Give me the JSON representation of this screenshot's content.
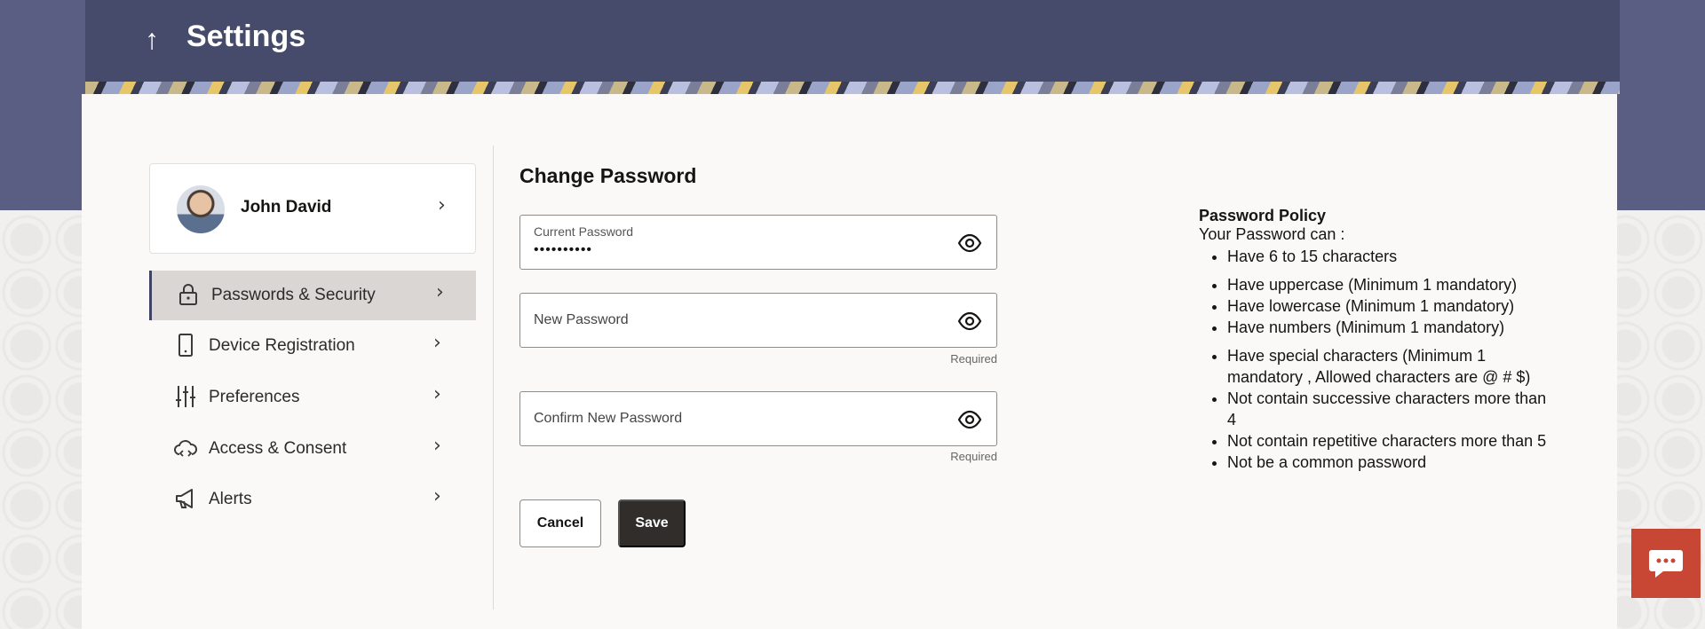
{
  "header": {
    "title": "Settings",
    "back_icon": "arrow-up-icon"
  },
  "profile": {
    "name": "John David"
  },
  "nav": {
    "items": [
      {
        "label": "Passwords & Security",
        "icon": "lock-icon",
        "active": true
      },
      {
        "label": "Device Registration",
        "icon": "mobile-device-icon",
        "active": false
      },
      {
        "label": "Preferences",
        "icon": "sliders-icon",
        "active": false
      },
      {
        "label": "Access & Consent",
        "icon": "cloud-access-icon",
        "active": false
      },
      {
        "label": "Alerts",
        "icon": "megaphone-icon",
        "active": false
      }
    ]
  },
  "form": {
    "title": "Change Password",
    "current_password": {
      "label": "Current Password",
      "value": "••••••••••"
    },
    "new_password": {
      "label": "New Password",
      "helper": "Required"
    },
    "confirm_password": {
      "label": "Confirm New Password",
      "helper": "Required"
    },
    "cancel_label": "Cancel",
    "save_label": "Save"
  },
  "policy": {
    "title": "Password Policy",
    "intro": "Your Password can :",
    "rules": [
      "Have 6 to 15 characters",
      "Have uppercase (Minimum 1 mandatory)",
      "Have lowercase (Minimum 1 mandatory)",
      "Have numbers (Minimum 1 mandatory)",
      "Have special characters (Minimum 1 mandatory , Allowed characters are @ # $)",
      "Not contain successive characters more than 4",
      "Not contain repetitive characters more than 5",
      "Not be a common password"
    ]
  },
  "colors": {
    "header": "#474b6b",
    "band": "#5a5e82",
    "save_button": "#312d2a",
    "chat_button": "#c74634"
  }
}
